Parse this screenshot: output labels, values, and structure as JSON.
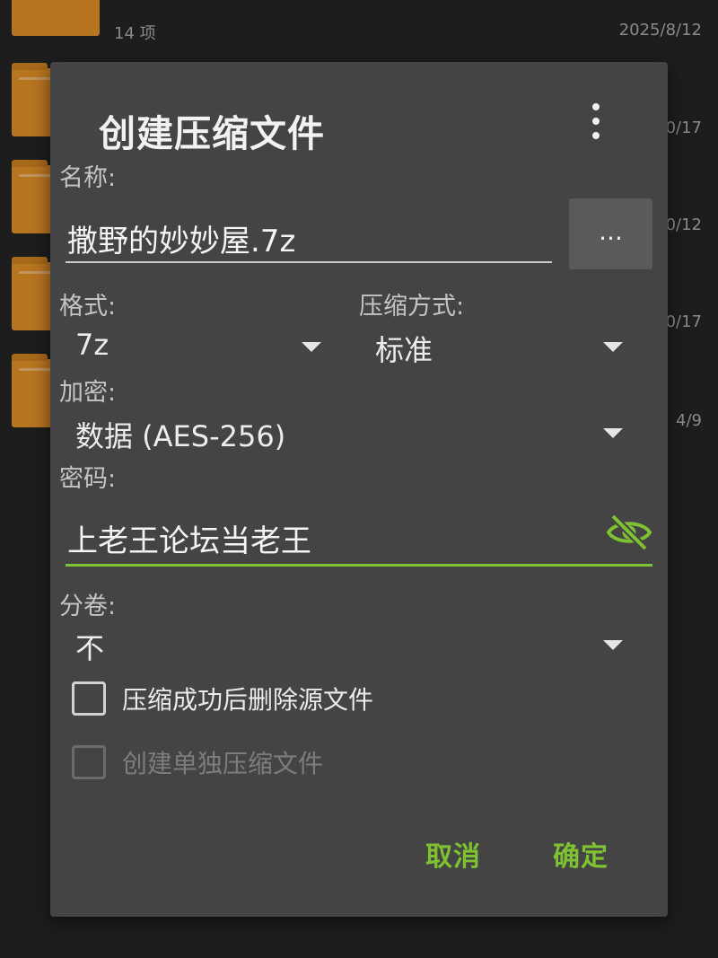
{
  "background": {
    "top_item_count": "14 项",
    "dates": [
      "2025/8/12",
      "0/17",
      "0/12",
      "0/17",
      "4/9"
    ]
  },
  "dialog": {
    "title": "创建压缩文件",
    "more_icon": "more-vertical-icon",
    "name": {
      "label": "名称:",
      "value": "撒野的妙妙屋.7z",
      "browse_label": "..."
    },
    "format": {
      "label": "格式:",
      "value": "7z"
    },
    "compression": {
      "label": "压缩方式:",
      "value": "标准"
    },
    "encryption": {
      "label": "加密:",
      "value": "数据 (AES-256)"
    },
    "password": {
      "label": "密码:",
      "value": "上老王论坛当老王",
      "visibility_icon": "eye-off-icon"
    },
    "split": {
      "label": "分卷:",
      "value": "不"
    },
    "options": [
      {
        "label": "压缩成功后删除源文件",
        "checked": false,
        "enabled": true
      },
      {
        "label": "创建单独压缩文件",
        "checked": false,
        "enabled": false
      }
    ],
    "buttons": {
      "cancel": "取消",
      "ok": "确定"
    }
  },
  "colors": {
    "accent": "#7ec232",
    "dialog_bg": "#444444",
    "screen_bg": "#1d1d1d",
    "folder": "#b87520"
  }
}
